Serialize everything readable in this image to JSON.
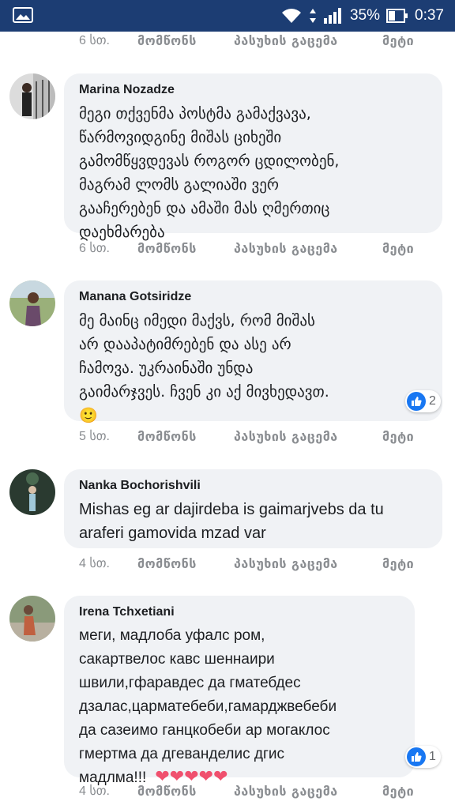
{
  "status_bar": {
    "battery_percent": "35%",
    "time": "0:37",
    "icons": [
      "gallery-icon",
      "wifi-icon",
      "data-arrows-icon",
      "signal-icon",
      "battery-icon"
    ]
  },
  "actions": {
    "like": "მომწონს",
    "reply": "პასუხის გაცემა",
    "more": "მეტი"
  },
  "top_row": {
    "time": "6 სთ."
  },
  "comments": [
    {
      "author": "Marina Nozadze",
      "text": "მეგი თქვენმა პოსტმა გამაქვავა,\nწარმოვიდგინე მიშას ციხეში\nგამომწყვდევას როგორ ცდილობენ,\nმაგრამ ლომს გალიაში ვერ\nგააჩერებენ და ამაში მას ღმერთიც\nდაეხმარება",
      "time": "6 სთ."
    },
    {
      "author": "Manana Gotsiridze",
      "text": "მე მაინც იმედი მაქვს, რომ მიშას\nარ დააპატიმრებენ და ასე არ\nჩამოვა. უკრაინაში უნდა\nგაიმარჯვეს. ჩვენ კი აქ მივხედავთ.",
      "emoji": "🙂",
      "reactions": "2",
      "time": "5 სთ."
    },
    {
      "author": "Nanka Bochorishvili",
      "text": "Mishas eg ar dajirdeba is gaimarjvebs da tu\naraferi gamovida mzad var",
      "time": "4 სთ."
    },
    {
      "author": "Irena Tchxetiani",
      "text": "меги, мадлоба уфалс ром,\nсакартвелос кавс шеннаири\nшвили,гфаравдес да гматебдес\nдзалас,царматебеби,гамарджвебеби\nда сазеимо ганцкобеби ар могаклос\nгмертма да дгеванделис дгис\nмадлма!!!",
      "emoji": "❤❤❤❤❤",
      "reactions": "1",
      "time": "4 სთ."
    }
  ],
  "colors": {
    "status_bar": "#1c3d73",
    "bubble": "#f0f2f5",
    "like_blue": "#1877f2",
    "heart": "#f0506e"
  }
}
